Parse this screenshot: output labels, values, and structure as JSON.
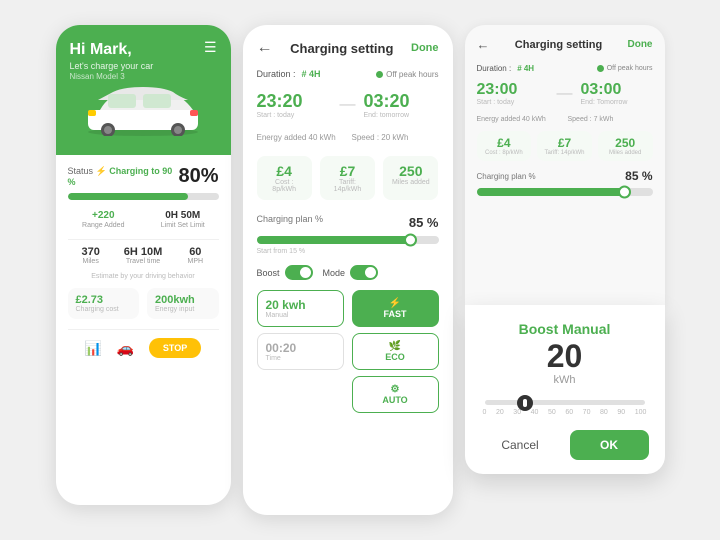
{
  "card1": {
    "greeting": "Hi Mark,",
    "subtitle": "Let's charge your car",
    "model": "Nissan Model 3",
    "status_label": "Status ⚡ Charging to 90 %",
    "percent": "80%",
    "progress": 80,
    "range_added_val": "+220",
    "range_added_label": "Range Added",
    "limit_val": "0H 50M",
    "limit_label": "Limit Set Limit",
    "miles": "370",
    "miles_label": "Miles",
    "travel_time": "6H 10M",
    "travel_label": "Travel time",
    "speed": "60",
    "speed_label": "MPH",
    "estimate_text": "Estimate by your driving behavior",
    "charging_cost_val": "£2.73",
    "charging_cost_label": "Charging cost",
    "energy_input_val": "200kwh",
    "energy_input_label": "Energy input",
    "stop_label": "STOP"
  },
  "card2": {
    "title": "Charging setting",
    "done": "Done",
    "duration_label": "Duration :",
    "duration_val": "# 4H",
    "peak_label": "Off peak hours",
    "start_time": "23:20",
    "start_sub": "Start : today",
    "end_time": "03:20",
    "end_sub": "End: tomorrow",
    "energy_added_label": "Energy added  40 kWh",
    "speed_label": "Speed : 20 kWh",
    "cost_val": "£4",
    "cost_desc": "Cost : 8p/kWh",
    "tariff_val": "£7",
    "tariff_desc": "Tariff: 14p/kWh",
    "miles_val": "250",
    "miles_desc": "Miles added",
    "plan_label": "Charging plan %",
    "plan_pct": "85 %",
    "slider_start": "Start from 15 %",
    "boost_label": "Boost",
    "mode_label": "Mode",
    "mode_fast": "FAST",
    "mode_eco": "ECO",
    "mode_auto": "AUTO",
    "boost_val": "20 kwh",
    "boost_sub": "Manual",
    "time_val": "00:20",
    "time_label": "Time"
  },
  "card3": {
    "title": "Charging setting",
    "done": "Done",
    "duration_label": "Duration :",
    "duration_val": "# 4H",
    "peak_label": "Off peak hours",
    "start_time": "23:00",
    "start_sub": "Start : today",
    "end_time": "03:00",
    "end_sub": "End: Tomorrow",
    "energy_label": "Energy added  40 kWh",
    "speed_label": "Speed : 7 kWh",
    "cost_val": "£4",
    "cost_desc": "Cost : 8p/kWh",
    "tariff_val": "£7",
    "tariff_desc": "Tariff: 14p/kWh",
    "miles_val": "250",
    "miles_desc": "Miles added",
    "plan_label": "Charging plan %",
    "plan_pct": "85 %"
  },
  "popup": {
    "title_normal": "Boost ",
    "title_green": "Manual",
    "kwh_val": "20",
    "kwh_unit": "kWh",
    "range_labels": [
      "0",
      "20",
      "30",
      "40",
      "50",
      "60",
      "70",
      "80",
      "90",
      "100"
    ],
    "cancel_label": "Cancel",
    "ok_label": "OK"
  }
}
